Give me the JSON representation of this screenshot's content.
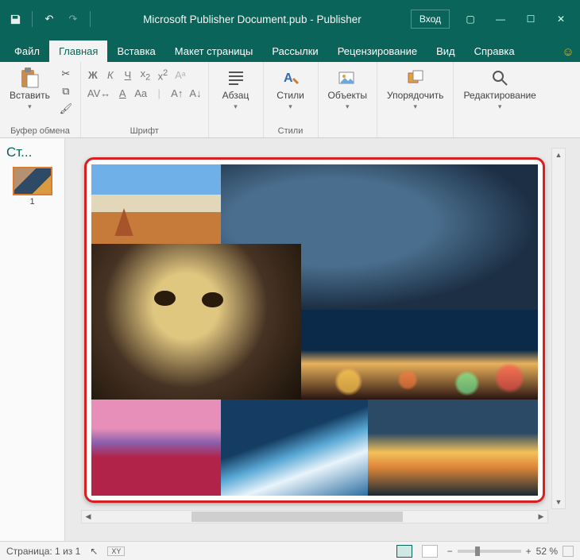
{
  "titlebar": {
    "document_title": "Microsoft Publisher Document.pub  -  Publisher",
    "account_label": "Вход"
  },
  "tabs": {
    "file": "Файл",
    "home": "Главная",
    "insert": "Вставка",
    "page_layout": "Макет страницы",
    "mailings": "Рассылки",
    "review": "Рецензирование",
    "view": "Вид",
    "help": "Справка"
  },
  "ribbon": {
    "clipboard": {
      "paste": "Вставить",
      "group_label": "Буфер обмена"
    },
    "font": {
      "group_label": "Шрифт"
    },
    "paragraph": {
      "btn": "Абзац"
    },
    "styles": {
      "btn": "Стили",
      "group_label": "Стили"
    },
    "objects": {
      "btn": "Объекты"
    },
    "arrange": {
      "btn": "Упорядочить"
    },
    "editing": {
      "btn": "Редактирование"
    }
  },
  "pages_panel": {
    "title": "Ст...",
    "page_number": "1"
  },
  "statusbar": {
    "page_info": "Страница: 1 из 1",
    "zoom_value": "52 %"
  }
}
